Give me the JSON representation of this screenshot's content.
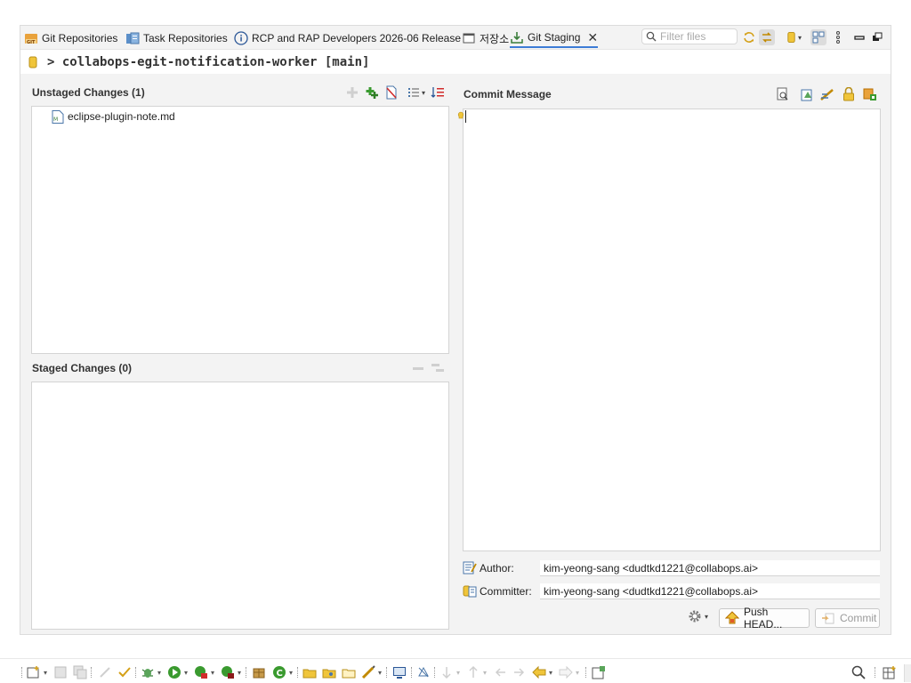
{
  "tabs": [
    {
      "label": "Git Repositories"
    },
    {
      "label": "Task Repositories"
    },
    {
      "label": "RCP and RAP Developers 2026-06 Release"
    },
    {
      "label": "저장소"
    },
    {
      "label": "Git Staging"
    }
  ],
  "filter": {
    "placeholder": "Filter files"
  },
  "repository": {
    "title": "> collabops-egit-notification-worker [main]"
  },
  "unstaged": {
    "title": "Unstaged Changes (1)",
    "files": [
      "eclipse-plugin-note.md"
    ]
  },
  "staged": {
    "title": "Staged Changes (0)"
  },
  "commit": {
    "title": "Commit Message",
    "message": "",
    "author_label": "Author:",
    "author_value": "kim-yeong-sang <dudtkd1221@collabops.ai>",
    "committer_label": "Committer:",
    "committer_value": "kim-yeong-sang <dudtkd1221@collabops.ai>",
    "push_label": "Push HEAD...",
    "commit_label": "Commit"
  },
  "colors": {
    "accent": "#3d7cd6",
    "staging_bg": "#f3f3f3",
    "border": "#d4d4d4"
  }
}
